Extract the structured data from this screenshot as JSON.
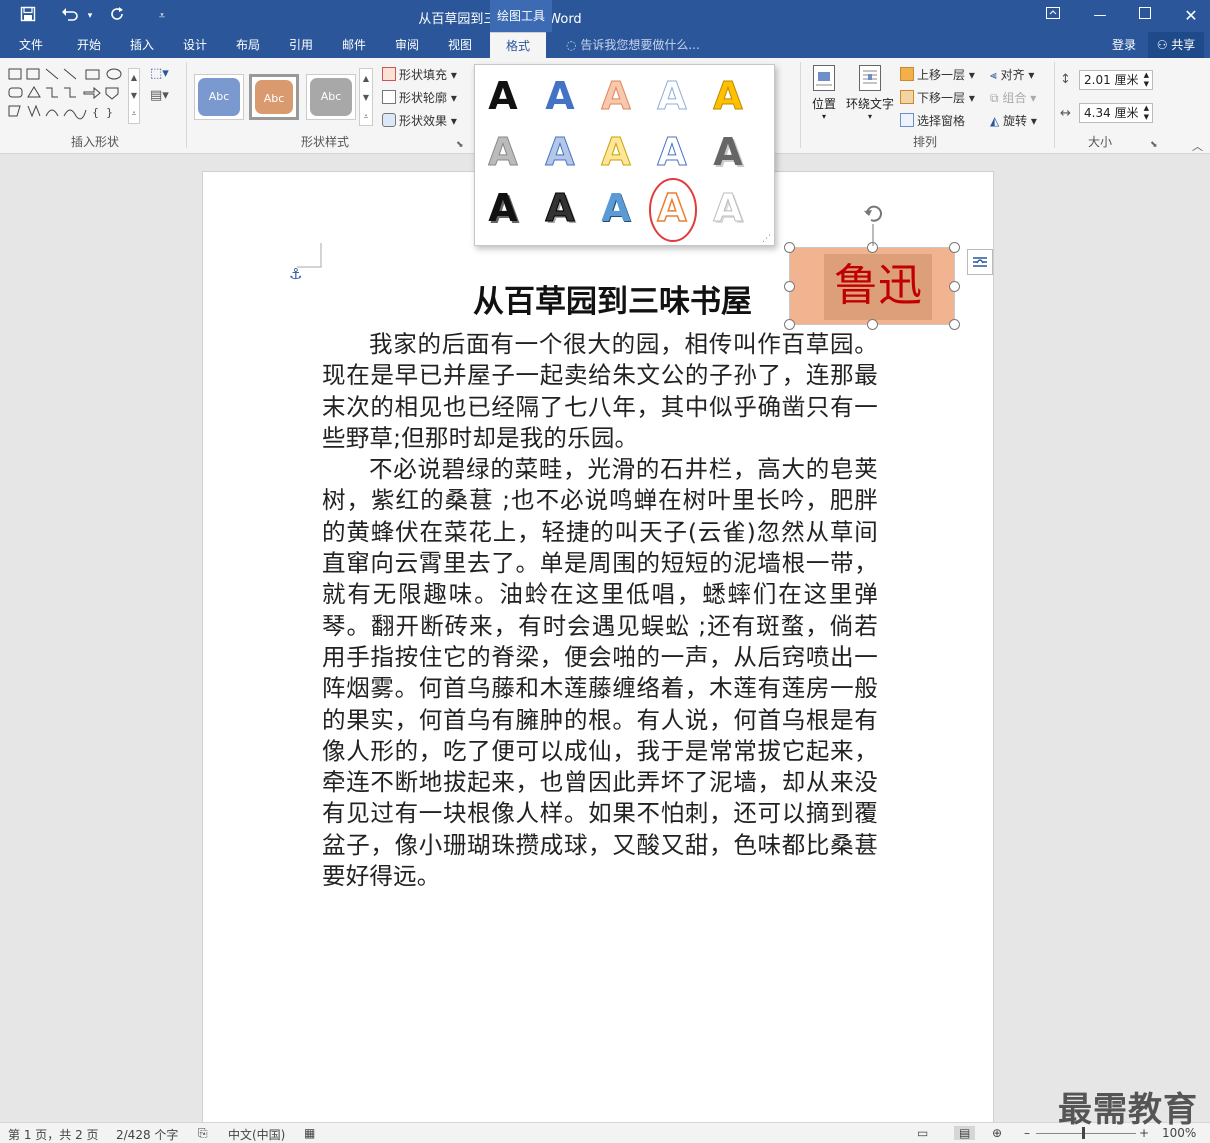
{
  "titlebar": {
    "title": "从百草园到三味书屋 - Word",
    "context_tab": "绘图工具",
    "save_icon": "save-icon",
    "undo_icon": "undo-icon",
    "redo_icon": "redo-icon"
  },
  "tabs": [
    "文件",
    "开始",
    "插入",
    "设计",
    "布局",
    "引用",
    "邮件",
    "审阅",
    "视图",
    "格式"
  ],
  "active_tab": "格式",
  "tell_me": "告诉我您想要做什么...",
  "account": {
    "login": "登录",
    "share": "共享"
  },
  "ribbon": {
    "insert_shapes_label": "插入形状",
    "shape_styles_label": "形状样式",
    "style_thumb_text": "Abc",
    "shape_fill": "形状填充",
    "shape_outline": "形状轮廓",
    "shape_effects": "形状效果",
    "position": "位置",
    "wrap_text": "环绕文字",
    "bring_forward": "上移一层",
    "send_backward": "下移一层",
    "selection_pane": "选择窗格",
    "align": "对齐",
    "group": "组合",
    "rotate": "旋转",
    "arrange_label": "排列",
    "height": "2.01 厘米",
    "width": "4.34 厘米",
    "size_label": "大小"
  },
  "wordart_gallery": {
    "glyph": "A"
  },
  "document": {
    "heading": "从百草园到三味书屋",
    "paragraphs": [
      "我家的后面有一个很大的园，相传叫作百草园。现在是早已并屋子一起卖给朱文公的子孙了，连那最末次的相见也已经隔了七八年，其中似乎确凿只有一些野草;但那时却是我的乐园。",
      "不必说碧绿的菜畦，光滑的石井栏，高大的皂荚树，紫红的桑葚  ;也不必说鸣蝉在树叶里长吟，肥胖的黄蜂伏在菜花上，轻捷的叫天子(云雀)忽然从草间直窜向云霄里去了。单是周围的短短的泥墙根一带，就有无限趣味。油蛉在这里低唱，蟋蟀们在这里弹琴。翻开断砖来，有时会遇见蜈蚣  ;还有斑蝥，倘若用手指按住它的脊梁，便会啪的一声，从后窍喷出一阵烟雾。何首乌藤和木莲藤缠络着，木莲有莲房一般的果实，何首乌有臃肿的根。有人说，何首乌根是有像人形的，吃了便可以成仙，我于是常常拔它起来，牵连不断地拔起来，也曾因此弄坏了泥墙，却从来没有见过有一块根像人样。如果不怕刺，还可以摘到覆盆子，像小珊瑚珠攒成球，又酸又甜，色味都比桑葚要好得远。"
    ],
    "shape_text": "鲁迅"
  },
  "statusbar": {
    "page": "第 1 页，共 2 页",
    "words": "2/428 个字",
    "language": "中文(中国)",
    "zoom": "100%"
  },
  "watermark": "最需教育",
  "colors": {
    "brand": "#2b579a",
    "shape_fill": "#f2b391",
    "shape_text": "#c00000",
    "highlight_circle": "#e03c3c"
  }
}
